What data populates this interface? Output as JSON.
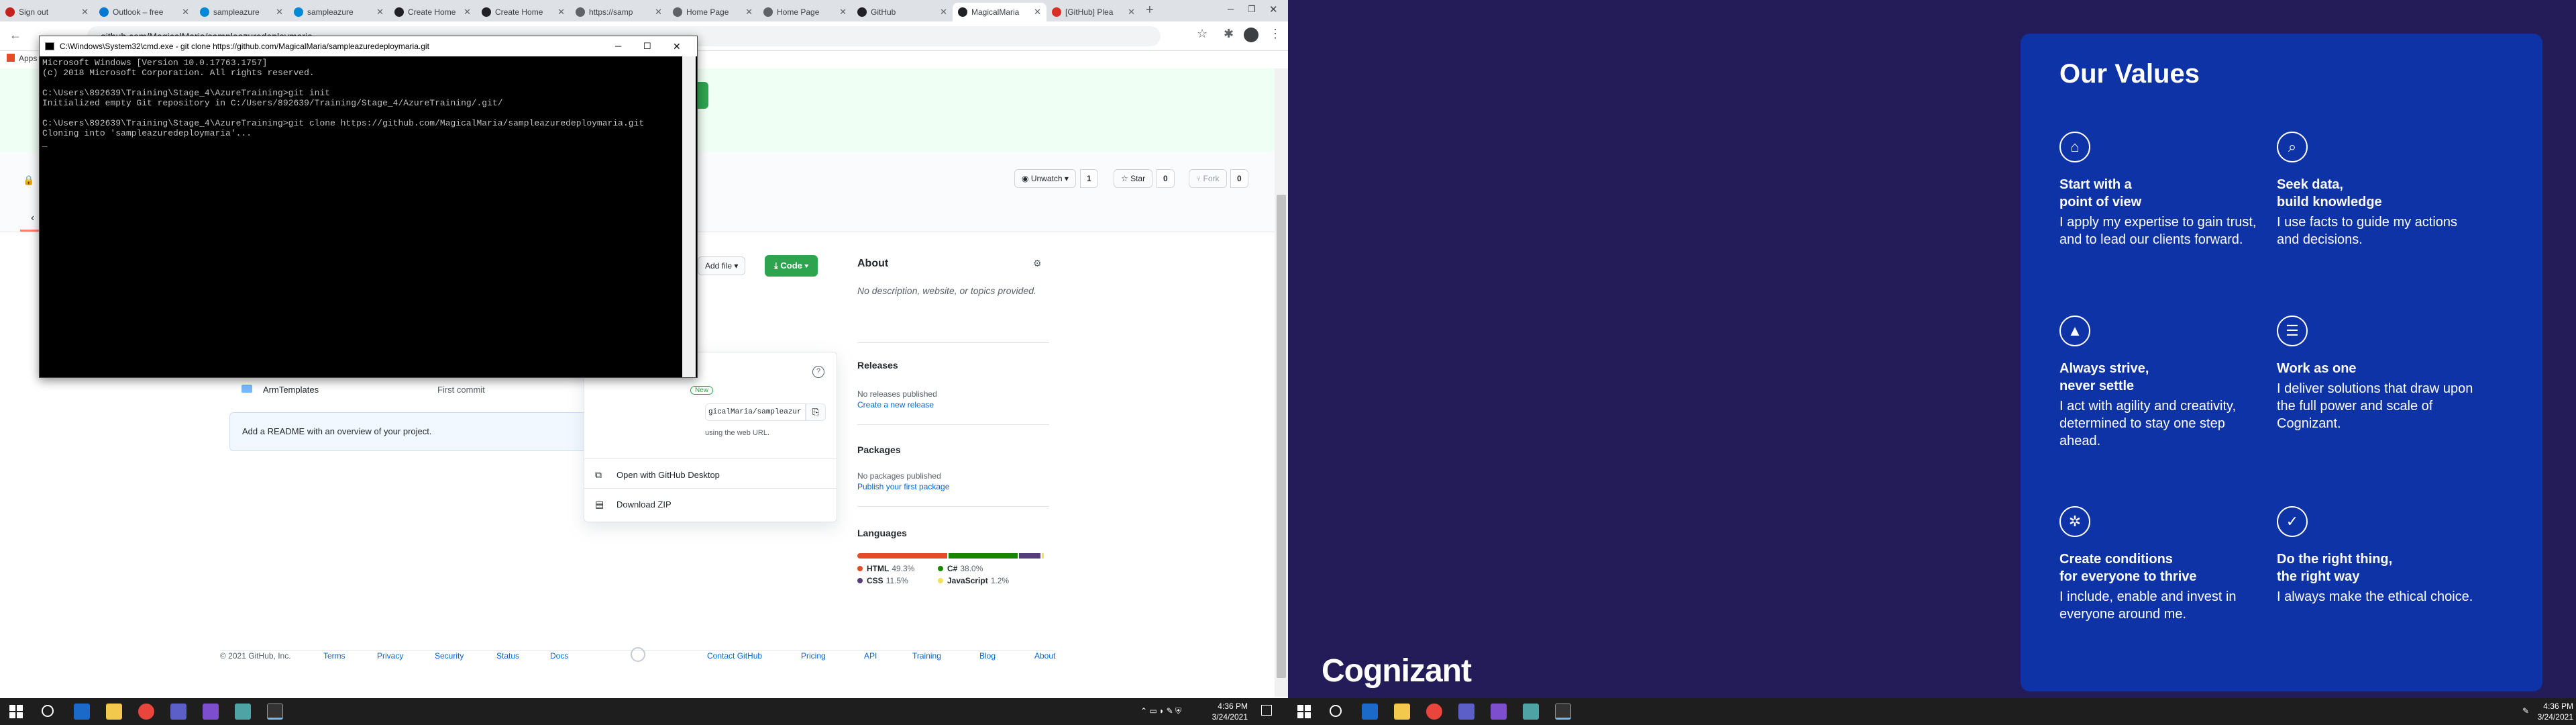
{
  "browser": {
    "tabs": [
      {
        "label": "Sign out",
        "color": "#c5221f"
      },
      {
        "label": "Outlook – free",
        "color": "#0078d4"
      },
      {
        "label": "sampleazure",
        "color": "#0089d6"
      },
      {
        "label": "sampleazure",
        "color": "#0089d6"
      },
      {
        "label": "Create Home",
        "color": "#202124"
      },
      {
        "label": "Create Home",
        "color": "#202124"
      },
      {
        "label": "https://samp",
        "color": "#5f6368"
      },
      {
        "label": "Home Page",
        "color": "#5f6368"
      },
      {
        "label": "Home Page",
        "color": "#5f6368"
      },
      {
        "label": "GitHub",
        "color": "#202124"
      },
      {
        "label": "MagicalMaria",
        "color": "#202124"
      },
      {
        "label": "[GitHub] Plea",
        "color": "#d93025"
      }
    ],
    "new_tab": "+",
    "url": "github.com/MagicalMaria/sampleazuredeploymaria",
    "bookmarks_label": "Apps"
  },
  "github": {
    "unwatch_label": "Unwatch",
    "unwatch_count": "1",
    "star_label": "Star",
    "star_count": "0",
    "fork_label": "Fork",
    "fork_count": "0",
    "add_file_label": "Add file",
    "code_label": "Code",
    "file_row": {
      "name": "ArmTemplates",
      "message": "First commit"
    },
    "readme_prompt": "Add a README with an overview of your project.",
    "clone_url_value": "gicalMaria/sampleazur",
    "new_badge": "New",
    "web_url_hint": "using the web URL.",
    "open_desktop_label": "Open with GitHub Desktop",
    "download_zip_label": "Download ZIP",
    "about": {
      "title": "About",
      "text": "No description, website, or topics provided."
    },
    "releases": {
      "title": "Releases",
      "text": "No releases published",
      "link": "Create a new release"
    },
    "packages": {
      "title": "Packages",
      "text": "No packages published",
      "link": "Publish your first package"
    },
    "languages": {
      "title": "Languages",
      "items": [
        {
          "name": "HTML",
          "pct": "49.3%",
          "value": 49.3,
          "color": "#e34c26"
        },
        {
          "name": "C#",
          "pct": "38.0%",
          "value": 38.0,
          "color": "#178600"
        },
        {
          "name": "CSS",
          "pct": "11.5%",
          "value": 11.5,
          "color": "#563d7c"
        },
        {
          "name": "JavaScript",
          "pct": "1.2%",
          "value": 1.2,
          "color": "#f1e05a"
        }
      ]
    },
    "footer": {
      "copyright": "© 2021 GitHub, Inc.",
      "links": [
        "Terms",
        "Privacy",
        "Security",
        "Status",
        "Docs",
        "Contact GitHub",
        "Pricing",
        "API",
        "Training",
        "Blog",
        "About"
      ]
    }
  },
  "cmd": {
    "title": "C:\\Windows\\System32\\cmd.exe - git  clone https://github.com/MagicalMaria/sampleazuredeploymaria.git",
    "lines": [
      "Microsoft Windows [Version 10.0.17763.1757]",
      "(c) 2018 Microsoft Corporation. All rights reserved.",
      "",
      "C:\\Users\\892639\\Training\\Stage_4\\AzureTraining>git init",
      "Initialized empty Git repository in C:/Users/892639/Training/Stage_4/AzureTraining/.git/",
      "",
      "C:\\Users\\892639\\Training\\Stage_4\\AzureTraining>git clone https://github.com/MagicalMaria/sampleazuredeploymaria.git",
      "Cloning into 'sampleazuredeploymaria'...",
      "_"
    ]
  },
  "taskbar_left": {
    "time": "4:36 PM",
    "date": "3/24/2021"
  },
  "taskbar_right": {
    "time": "4:36 PM",
    "date": "3/24/2021"
  },
  "panel": {
    "title": "Our Values",
    "values": [
      {
        "icon": "person-at-desk-icon",
        "glyph": "⌂",
        "heading": "Start with a\npoint of view",
        "body": "I apply my expertise to gain trust, and to lead our clients forward."
      },
      {
        "icon": "data-search-icon",
        "glyph": "⌕",
        "heading": "Seek data,\nbuild knowledge",
        "body": "I use facts to guide my actions and decisions."
      },
      {
        "icon": "mountain-climb-icon",
        "glyph": "▲",
        "heading": "Always strive,\nnever settle",
        "body": "I act with agility and creativity, determined to stay one step ahead."
      },
      {
        "icon": "team-icon",
        "glyph": "☰",
        "heading": "Work as one",
        "body": "I deliver solutions that draw upon the full power and scale of Cognizant."
      },
      {
        "icon": "inclusion-gear-icon",
        "glyph": "✲",
        "heading": "Create conditions\nfor everyone to thrive",
        "body": "I include, enable and invest in everyone around me."
      },
      {
        "icon": "shield-check-icon",
        "glyph": "✓",
        "heading": "Do the right thing,\nthe right way",
        "body": "I always make the ethical choice."
      }
    ],
    "logo": "Cognizant"
  }
}
